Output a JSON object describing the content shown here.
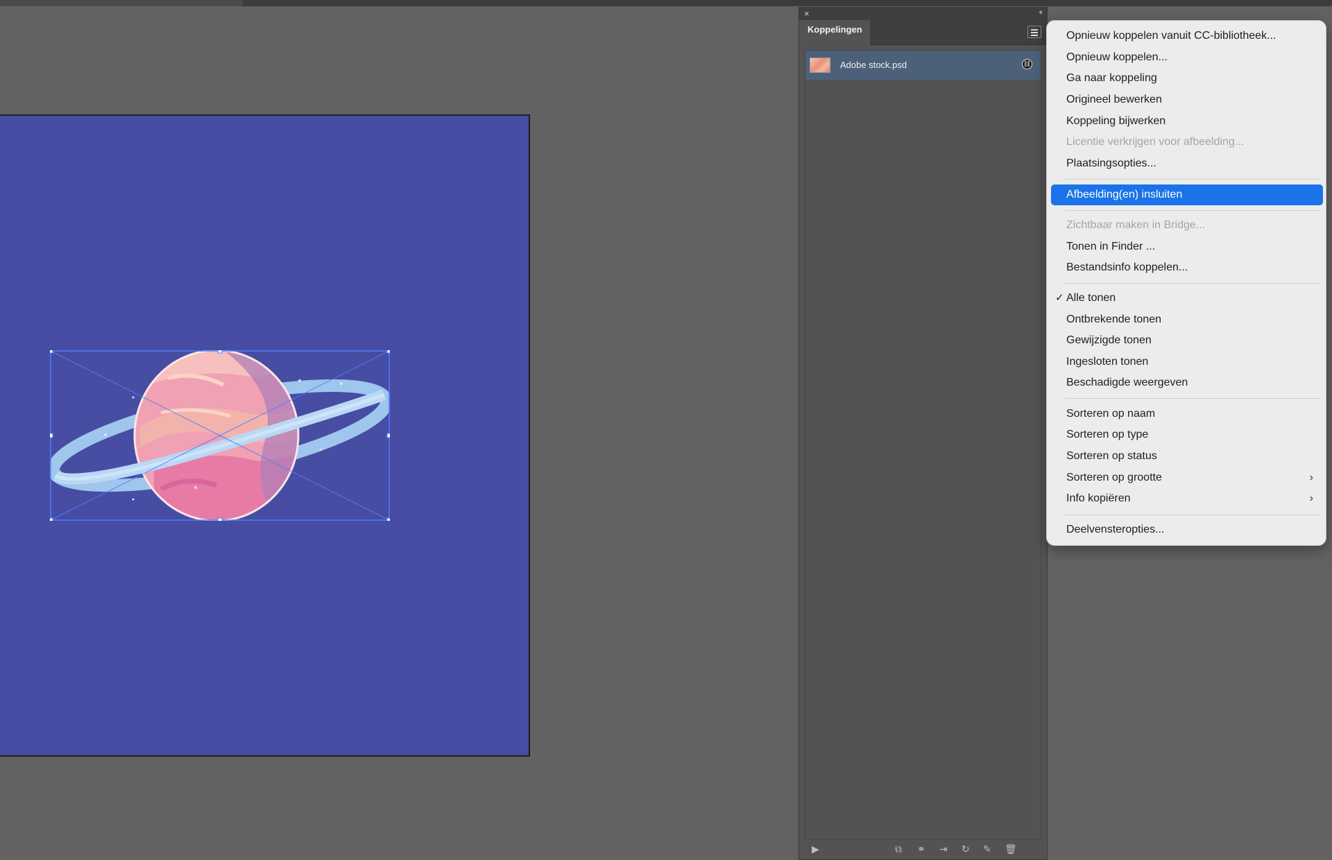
{
  "panel": {
    "title": "Koppelingen",
    "close_icon": "×",
    "collapse_icon": "‹‹",
    "links": [
      {
        "name": "Adobe stock.psd"
      }
    ],
    "footer_icons": [
      "expand-icon",
      "relink-cc-icon",
      "relink-icon",
      "go-to-link-icon",
      "update-link-icon",
      "edit-original-icon",
      "delete-icon"
    ]
  },
  "context_menu": {
    "items": [
      {
        "label": "Opnieuw koppelen vanuit CC-bibliotheek..."
      },
      {
        "label": "Opnieuw koppelen..."
      },
      {
        "label": "Ga naar koppeling"
      },
      {
        "label": "Origineel bewerken"
      },
      {
        "label": "Koppeling bijwerken"
      },
      {
        "label": "Licentie verkrijgen voor afbeelding...",
        "disabled": true
      },
      {
        "label": "Plaatsingsopties..."
      },
      {
        "label": "Afbeelding(en) insluiten",
        "highlighted": true
      },
      {
        "label": "Zichtbaar maken in Bridge...",
        "disabled": true
      },
      {
        "label": "Tonen in Finder ..."
      },
      {
        "label": "Bestandsinfo koppelen..."
      },
      {
        "label": "Alle tonen",
        "checked": true
      },
      {
        "label": "Ontbrekende tonen"
      },
      {
        "label": "Gewijzigde tonen"
      },
      {
        "label": "Ingesloten tonen"
      },
      {
        "label": "Beschadigde weergeven"
      },
      {
        "label": "Sorteren op naam"
      },
      {
        "label": "Sorteren op type"
      },
      {
        "label": "Sorteren op status"
      },
      {
        "label": "Sorteren op grootte",
        "submenu": true
      },
      {
        "label": "Info kopiëren",
        "submenu": true
      },
      {
        "label": "Deelvensteropties..."
      }
    ],
    "checkmark": "✓",
    "submenu_arrow": "›"
  },
  "colors": {
    "artboard": "#474da3",
    "highlight": "#1a73e8",
    "selection": "#4f7cff"
  }
}
